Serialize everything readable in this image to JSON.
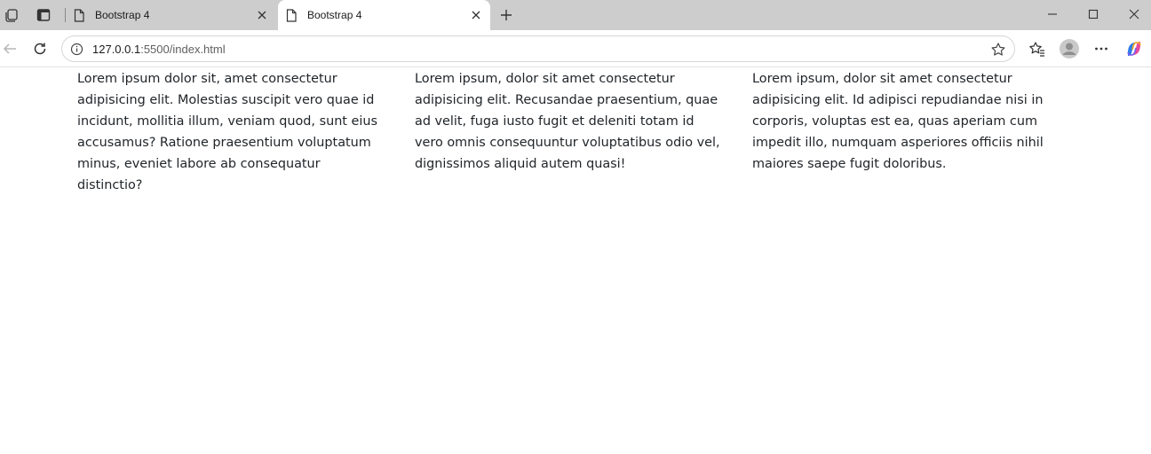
{
  "browser": {
    "tabs": [
      {
        "title": "Bootstrap 4",
        "active": false
      },
      {
        "title": "Bootstrap 4",
        "active": true
      }
    ],
    "address": {
      "host": "127.0.0.1",
      "rest": ":5500/index.html"
    }
  },
  "icons": {
    "workspaces": "workspaces-icon",
    "tab_actions": "tab-actions-icon",
    "page": "page-icon",
    "close": "close-icon",
    "new_tab": "plus-icon",
    "minimize": "minimize-icon",
    "maximize": "maximize-icon",
    "window_close": "window-close-icon",
    "back": "back-arrow-icon",
    "refresh": "refresh-icon",
    "info": "info-icon",
    "favorite": "star-icon",
    "favorites": "favorites-icon",
    "profile": "profile-icon",
    "more": "more-icon",
    "copilot": "copilot-icon"
  },
  "colors": {
    "tabstrip": "#cdcdcd",
    "active_tab": "#ffffff",
    "text": "#212529"
  },
  "content": {
    "columns": [
      {
        "text": "Lorem ipsum dolor sit, amet consectetur adipisicing elit. Molestias suscipit vero quae id incidunt, mollitia illum, veniam quod, sunt eius accusamus? Ratione praesentium voluptatum minus, eveniet labore ab consequatur distinctio?"
      },
      {
        "text": "Lorem ipsum, dolor sit amet consectetur adipisicing elit. Recusandae praesentium, quae ad velit, fuga iusto fugit et deleniti totam id vero omnis consequuntur voluptatibus odio vel, dignissimos aliquid autem quasi!"
      },
      {
        "text": "Lorem ipsum, dolor sit amet consectetur adipisicing elit. Id adipisci repudiandae nisi in corporis, voluptas est ea, quas aperiam cum impedit illo, numquam asperiores officiis nihil maiores saepe fugit doloribus."
      }
    ]
  }
}
